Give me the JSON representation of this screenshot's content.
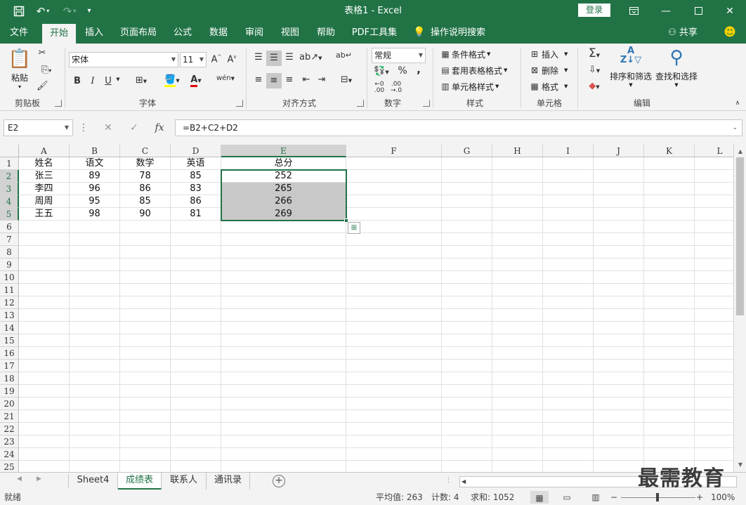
{
  "window": {
    "title": "表格1  -  Excel",
    "login_label": "登录"
  },
  "tabs": [
    "文件",
    "开始",
    "插入",
    "页面布局",
    "公式",
    "数据",
    "审阅",
    "视图",
    "帮助",
    "PDF工具集",
    "操作说明搜索"
  ],
  "share_label": "共享",
  "ribbon": {
    "clipboard": {
      "paste_label": "粘贴",
      "group_label": "剪贴板"
    },
    "font": {
      "font_name": "宋体",
      "font_size": "11",
      "group_label": "字体",
      "bold": "B",
      "italic": "I",
      "underline": "U"
    },
    "alignment": {
      "group_label": "对齐方式"
    },
    "number": {
      "format": "常规",
      "percent": "%",
      "comma": ",",
      "group_label": "数字"
    },
    "styles": {
      "conditional": "条件格式",
      "table_format": "套用表格格式",
      "cell_styles": "单元格样式",
      "group_label": "样式"
    },
    "cells": {
      "insert": "插入",
      "delete": "删除",
      "format": "格式",
      "group_label": "单元格"
    },
    "editing": {
      "sort_filter": "排序和筛选",
      "find_select": "查找和选择",
      "group_label": "编辑"
    }
  },
  "formula_bar": {
    "name_box": "E2",
    "fx": "fx",
    "formula": "=B2+C2+D2"
  },
  "columns": [
    "A",
    "B",
    "C",
    "D",
    "E",
    "F",
    "G",
    "H",
    "I",
    "J",
    "K",
    "L"
  ],
  "rows": [
    "1",
    "2",
    "3",
    "4",
    "5",
    "6",
    "7",
    "8",
    "9",
    "10",
    "11",
    "12",
    "13",
    "14",
    "15",
    "16",
    "17",
    "18",
    "19",
    "20",
    "21",
    "22",
    "23",
    "24",
    "25"
  ],
  "table": {
    "headers": [
      "姓名",
      "语文",
      "数学",
      "英语",
      "总分"
    ],
    "data": [
      [
        "张三",
        "89",
        "78",
        "85",
        "252"
      ],
      [
        "李四",
        "96",
        "86",
        "83",
        "265"
      ],
      [
        "周周",
        "95",
        "85",
        "86",
        "266"
      ],
      [
        "王五",
        "98",
        "90",
        "81",
        "269"
      ]
    ]
  },
  "sheets": [
    "Sheet4",
    "成绩表",
    "联系人",
    "通讯录"
  ],
  "active_sheet": "成绩表",
  "status": {
    "ready": "就绪",
    "average": "平均值: 263",
    "count": "计数: 4",
    "sum": "求和: 1052",
    "zoom": "100%"
  },
  "watermark": "最需教育"
}
